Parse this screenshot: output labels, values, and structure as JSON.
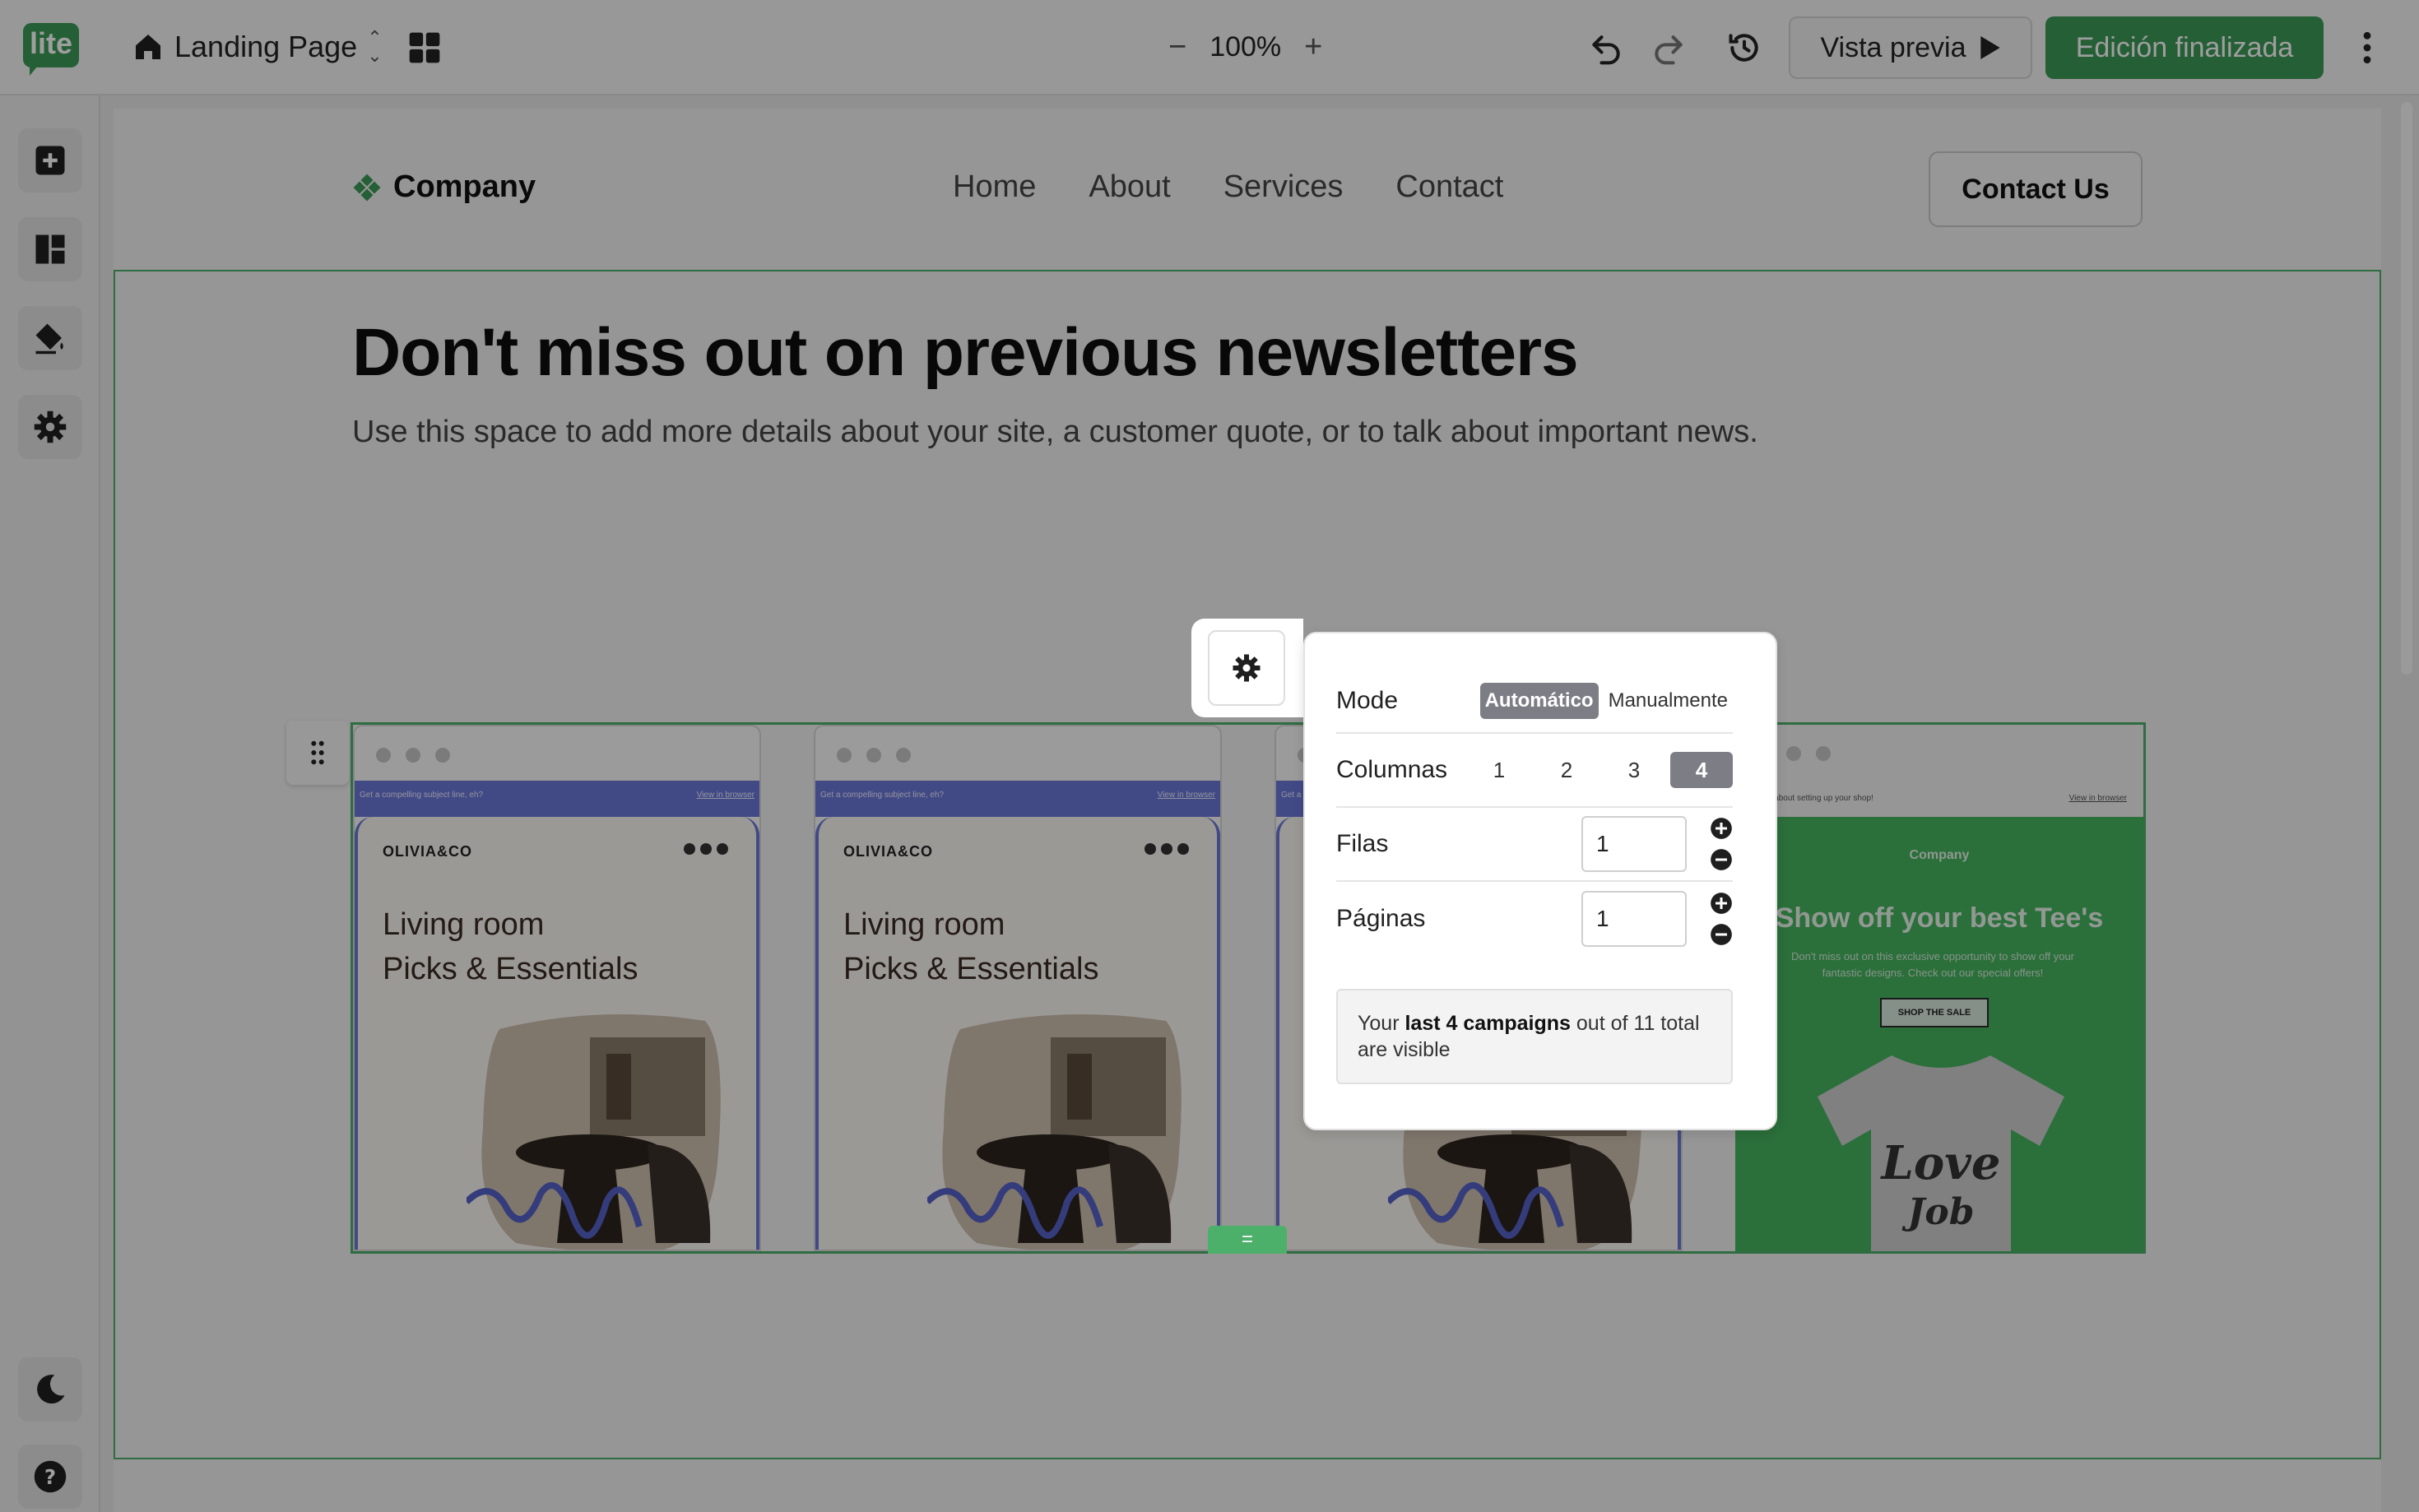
{
  "topbar": {
    "logo_text": "lite",
    "page_name": "Landing Page",
    "zoom_value": "100%",
    "zoom_minus": "−",
    "zoom_plus": "+",
    "preview_label": "Vista previa",
    "done_label": "Edición finalizada"
  },
  "site": {
    "brand": "Company",
    "nav": [
      "Home",
      "About",
      "Services",
      "Contact"
    ],
    "cta": "Contact Us",
    "hero_title": "Don't miss out on previous newsletters",
    "hero_subtitle": "Use this space to add more details about your site, a customer quote, or to talk about important news."
  },
  "cards": {
    "preheader": "Get a compelling subject line, eh?",
    "view_in_browser": "View in browser",
    "brand": "OLIVIA&CO",
    "title_line1": "Living room",
    "title_line2": "Picks & Essentials",
    "card4_preheader": "...you go about setting up your shop!",
    "card4_brand": "Company",
    "card4_title": "Show off your best Tee's",
    "card4_body": "Don't miss out on this exclusive opportunity to show off your fantastic designs. Check out our special offers!",
    "card4_button": "SHOP THE SALE"
  },
  "popover": {
    "mode_label": "Mode",
    "mode_options": [
      "Automático",
      "Manualmente"
    ],
    "mode_selected": "Automático",
    "columns_label": "Columnas",
    "columns_options": [
      "1",
      "2",
      "3",
      "4"
    ],
    "columns_selected": "4",
    "rows_label": "Filas",
    "rows_value": "1",
    "pages_label": "Páginas",
    "pages_value": "1",
    "info_prefix": "Your ",
    "info_bold": "last 4 campaigns",
    "info_suffix": " out of 11 total are visible"
  },
  "colors": {
    "accent_green": "#3d9a57",
    "selection_green": "#4caf6a",
    "email_blue": "#6b78d8",
    "segment_active": "#7d7d85"
  }
}
